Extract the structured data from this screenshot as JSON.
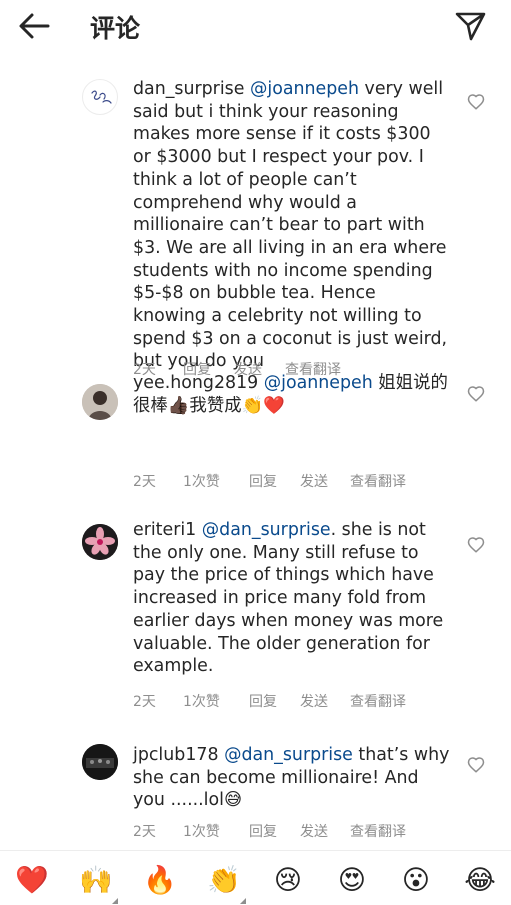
{
  "header": {
    "title": "评论"
  },
  "comments": [
    {
      "username": "dan_surprise",
      "mention": "@joannepeh",
      "text": " very well said but i think your reasoning makes more sense if it costs $300 or $3000 but I respect your pov. I think a lot of people can’t comprehend why would a millionaire can’t bear to part with $3. We are all living in an era where students with no income spending $5-$8 on bubble tea. Hence knowing a celebrity not willing to spend $3 on a coconut is just weird, but you do you",
      "time": "2天",
      "likes": "",
      "reply": "回复",
      "send": "发送",
      "translate": "查看翻译"
    },
    {
      "username": "yee.hong2819",
      "mention": "@joannepeh",
      "text": " 姐姐说的很棒👍🏿我赞成👏❤️",
      "time": "2天",
      "likes": "1次赞",
      "reply": "回复",
      "send": "发送",
      "translate": "查看翻译"
    },
    {
      "username": "eriteri1",
      "mention": "@dan_surprise",
      "text": ".  she is not the only one. Many still refuse to pay the price of things which have increased in price many fold from earlier days when money was more valuable. The older generation for example.",
      "time": "2天",
      "likes": "1次赞",
      "reply": "回复",
      "send": "发送",
      "translate": "查看翻译"
    },
    {
      "username": "jpclub178",
      "mention": "@dan_surprise",
      "text": " that’s why she can become millionaire! And you ......lol😅",
      "time": "2天",
      "likes": "1次赞",
      "reply": "回复",
      "send": "发送",
      "translate": "查看翻译"
    }
  ],
  "emoji_bar": [
    {
      "icon": "red-heart-icon",
      "glyph": "❤️"
    },
    {
      "icon": "raising-hands-icon",
      "glyph": "🙌"
    },
    {
      "icon": "fire-icon",
      "glyph": "🔥"
    },
    {
      "icon": "clapping-hands-icon",
      "glyph": "👏"
    },
    {
      "icon": "crying-face-icon",
      "glyph": "😢"
    },
    {
      "icon": "heart-eyes-icon",
      "glyph": "😍"
    },
    {
      "icon": "surprised-face-icon",
      "glyph": "😮"
    },
    {
      "icon": "tears-of-joy-icon",
      "glyph": "😂"
    }
  ],
  "colors": {
    "text": "#262626",
    "mention": "#0a4a8c",
    "meta": "#8e8e8e",
    "like_outline": "#8e8e8e"
  }
}
